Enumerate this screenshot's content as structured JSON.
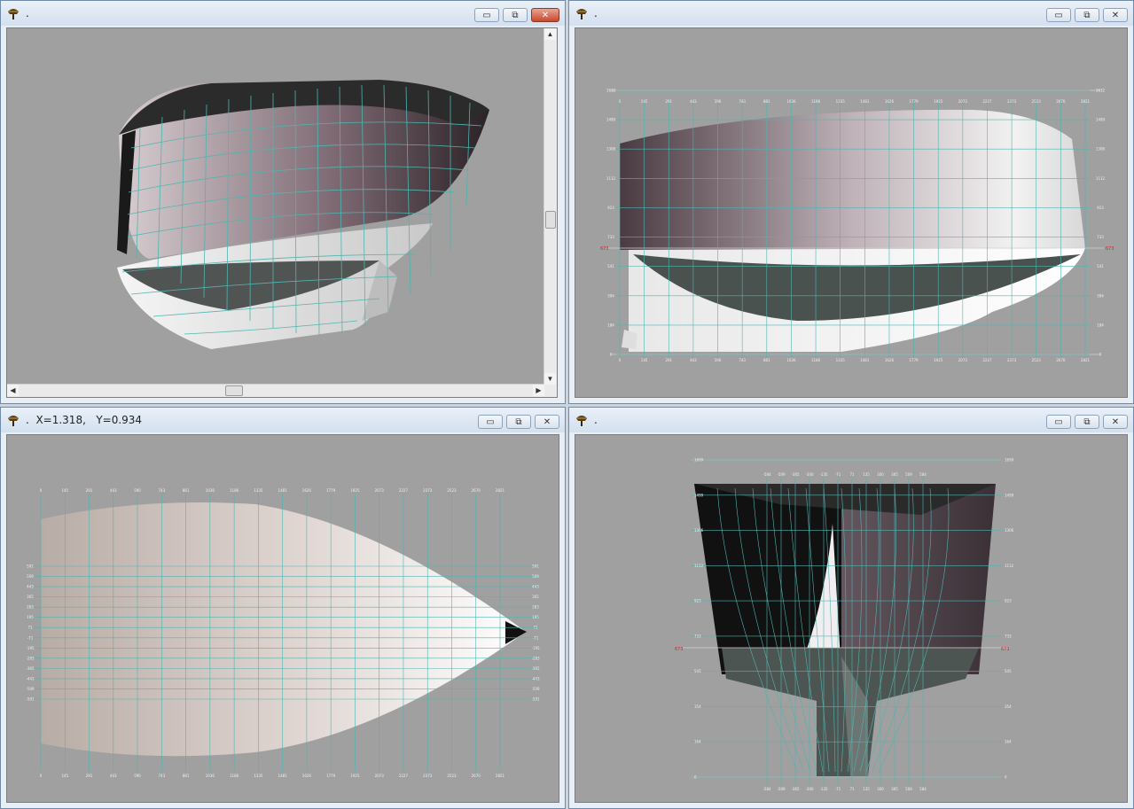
{
  "windows": [
    {
      "title": ".",
      "view": "perspective"
    },
    {
      "title": ".",
      "view": "side-profile"
    },
    {
      "title": ".  X=1.318,   Y=0.934",
      "view": "plan"
    },
    {
      "title": ".",
      "view": "body-plan"
    }
  ],
  "icons": {
    "app": "ship-icon",
    "minimize": "minimize-icon",
    "restore": "restore-icon",
    "close": "close-icon"
  },
  "glyphs": {
    "minimize": "▭",
    "restore": "⧉",
    "close": "✕",
    "arrow_up": "▲",
    "arrow_down": "▼",
    "arrow_left": "◀",
    "arrow_right": "▶"
  },
  "side_view": {
    "x_ticks": [
      "0",
      "145",
      "291",
      "443",
      "590",
      "743",
      "881",
      "1036",
      "1186",
      "1335",
      "1481",
      "1626",
      "1779",
      "1925",
      "2073",
      "2227",
      "2373",
      "2523",
      "2670",
      "2821"
    ],
    "y_ticks_left": [
      "1632",
      "1499",
      "1306",
      "1112",
      "923",
      "733",
      "541",
      "394",
      "184",
      "0"
    ],
    "waterline_label": "673"
  },
  "plan_view": {
    "x_ticks": [
      "0",
      "145",
      "291",
      "443",
      "590",
      "743",
      "881",
      "1036",
      "1186",
      "1335",
      "1481",
      "1626",
      "1779",
      "1925",
      "2073",
      "2227",
      "2373",
      "2523",
      "2670",
      "2821"
    ],
    "y_ticks": [
      "591",
      "509",
      "443",
      "365",
      "283",
      "195",
      "71",
      "-71",
      "-195",
      "-283",
      "-365",
      "-443",
      "-509",
      "-591"
    ]
  },
  "body_view": {
    "top_ticks": [
      "-584",
      "-509",
      "-365",
      "-300",
      "-135",
      "-71",
      "71",
      "135",
      "300",
      "365",
      "509",
      "584"
    ],
    "y_ticks": [
      "1699",
      "1499",
      "1306",
      "1112",
      "923",
      "733",
      "545",
      "354",
      "164",
      "0"
    ],
    "waterline_label": "673"
  },
  "colors": {
    "viewport_bg": "#a0a0a0",
    "grid": "#4fb5b0",
    "axis_text": "#f0f0f0",
    "waterline": "#e02020"
  }
}
